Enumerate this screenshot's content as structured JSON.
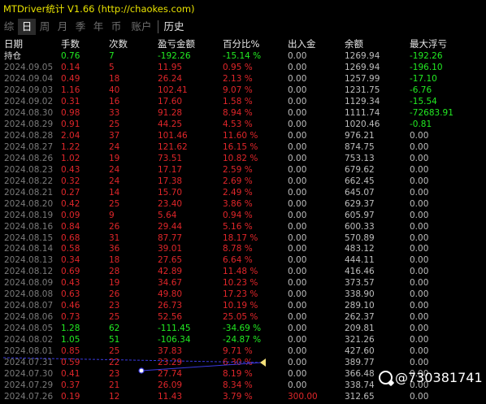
{
  "title": "MTDriver统计 V1.66  (http://chaokes.com)",
  "tabs": [
    "综",
    "日",
    "周",
    "月",
    "季",
    "年",
    "币",
    "账户",
    "历史"
  ],
  "columns": [
    "日期",
    "手数",
    "次数",
    "盈亏金额",
    "百分比%",
    "出入金",
    "余额",
    "最大浮亏"
  ],
  "holding": {
    "date": "持仓",
    "lots": "0.76",
    "count": "7",
    "pnl": "-192.26",
    "pct": "-15.14 %",
    "dw": "0.00",
    "balance": "1269.94",
    "maxdd": "-192.26"
  },
  "rows": [
    {
      "date": "2024.09.05",
      "lots": "0.14",
      "count": "5",
      "pnl": "11.95",
      "pct": "0.95 %",
      "dw": "0.00",
      "balance": "1269.94",
      "maxdd": "-196.10"
    },
    {
      "date": "2024.09.04",
      "lots": "0.49",
      "count": "18",
      "pnl": "26.24",
      "pct": "2.13 %",
      "dw": "0.00",
      "balance": "1257.99",
      "maxdd": "-17.10"
    },
    {
      "date": "2024.09.03",
      "lots": "1.16",
      "count": "40",
      "pnl": "102.41",
      "pct": "9.07 %",
      "dw": "0.00",
      "balance": "1231.75",
      "maxdd": "-6.76"
    },
    {
      "date": "2024.09.02",
      "lots": "0.31",
      "count": "16",
      "pnl": "17.60",
      "pct": "1.58 %",
      "dw": "0.00",
      "balance": "1129.34",
      "maxdd": "-15.54"
    },
    {
      "date": "2024.08.30",
      "lots": "0.98",
      "count": "33",
      "pnl": "91.28",
      "pct": "8.94 %",
      "dw": "0.00",
      "balance": "1111.74",
      "maxdd": "-72683.91"
    },
    {
      "date": "2024.08.29",
      "lots": "0.91",
      "count": "25",
      "pnl": "44.25",
      "pct": "4.53 %",
      "dw": "0.00",
      "balance": "1020.46",
      "maxdd": "-0.81"
    },
    {
      "date": "2024.08.28",
      "lots": "2.04",
      "count": "37",
      "pnl": "101.46",
      "pct": "11.60 %",
      "dw": "0.00",
      "balance": "976.21",
      "maxdd": "0.00"
    },
    {
      "date": "2024.08.27",
      "lots": "1.22",
      "count": "24",
      "pnl": "121.62",
      "pct": "16.15 %",
      "dw": "0.00",
      "balance": "874.75",
      "maxdd": "0.00"
    },
    {
      "date": "2024.08.26",
      "lots": "1.02",
      "count": "19",
      "pnl": "73.51",
      "pct": "10.82 %",
      "dw": "0.00",
      "balance": "753.13",
      "maxdd": "0.00"
    },
    {
      "date": "2024.08.23",
      "lots": "0.43",
      "count": "24",
      "pnl": "17.17",
      "pct": "2.59 %",
      "dw": "0.00",
      "balance": "679.62",
      "maxdd": "0.00"
    },
    {
      "date": "2024.08.22",
      "lots": "0.32",
      "count": "24",
      "pnl": "17.38",
      "pct": "2.69 %",
      "dw": "0.00",
      "balance": "662.45",
      "maxdd": "0.00"
    },
    {
      "date": "2024.08.21",
      "lots": "0.27",
      "count": "14",
      "pnl": "15.70",
      "pct": "2.49 %",
      "dw": "0.00",
      "balance": "645.07",
      "maxdd": "0.00"
    },
    {
      "date": "2024.08.20",
      "lots": "0.42",
      "count": "25",
      "pnl": "23.40",
      "pct": "3.86 %",
      "dw": "0.00",
      "balance": "629.37",
      "maxdd": "0.00"
    },
    {
      "date": "2024.08.19",
      "lots": "0.09",
      "count": "9",
      "pnl": "5.64",
      "pct": "0.94 %",
      "dw": "0.00",
      "balance": "605.97",
      "maxdd": "0.00"
    },
    {
      "date": "2024.08.16",
      "lots": "0.84",
      "count": "26",
      "pnl": "29.44",
      "pct": "5.16 %",
      "dw": "0.00",
      "balance": "600.33",
      "maxdd": "0.00"
    },
    {
      "date": "2024.08.15",
      "lots": "0.68",
      "count": "31",
      "pnl": "87.77",
      "pct": "18.17 %",
      "dw": "0.00",
      "balance": "570.89",
      "maxdd": "0.00"
    },
    {
      "date": "2024.08.14",
      "lots": "0.58",
      "count": "36",
      "pnl": "39.01",
      "pct": "8.78 %",
      "dw": "0.00",
      "balance": "483.12",
      "maxdd": "0.00"
    },
    {
      "date": "2024.08.13",
      "lots": "0.34",
      "count": "18",
      "pnl": "27.65",
      "pct": "6.64 %",
      "dw": "0.00",
      "balance": "444.11",
      "maxdd": "0.00"
    },
    {
      "date": "2024.08.12",
      "lots": "0.69",
      "count": "28",
      "pnl": "42.89",
      "pct": "11.48 %",
      "dw": "0.00",
      "balance": "416.46",
      "maxdd": "0.00"
    },
    {
      "date": "2024.08.09",
      "lots": "0.43",
      "count": "19",
      "pnl": "34.67",
      "pct": "10.23 %",
      "dw": "0.00",
      "balance": "373.57",
      "maxdd": "0.00"
    },
    {
      "date": "2024.08.08",
      "lots": "0.63",
      "count": "26",
      "pnl": "49.80",
      "pct": "17.23 %",
      "dw": "0.00",
      "balance": "338.90",
      "maxdd": "0.00"
    },
    {
      "date": "2024.08.07",
      "lots": "0.46",
      "count": "23",
      "pnl": "26.73",
      "pct": "10.19 %",
      "dw": "0.00",
      "balance": "289.10",
      "maxdd": "0.00"
    },
    {
      "date": "2024.08.06",
      "lots": "0.73",
      "count": "25",
      "pnl": "52.56",
      "pct": "25.05 %",
      "dw": "0.00",
      "balance": "262.37",
      "maxdd": "0.00"
    },
    {
      "date": "2024.08.05",
      "lots": "1.28",
      "count": "62",
      "pnl": "-111.45",
      "pct": "-34.69 %",
      "dw": "0.00",
      "balance": "209.81",
      "maxdd": "0.00"
    },
    {
      "date": "2024.08.02",
      "lots": "1.05",
      "count": "51",
      "pnl": "-106.34",
      "pct": "-24.87 %",
      "dw": "0.00",
      "balance": "321.26",
      "maxdd": "0.00"
    },
    {
      "date": "2024.08.01",
      "lots": "0.85",
      "count": "25",
      "pnl": "37.83",
      "pct": "9.71 %",
      "dw": "0.00",
      "balance": "427.60",
      "maxdd": "0.00"
    },
    {
      "date": "2024.07.31",
      "lots": "0.59",
      "count": "22",
      "pnl": "23.29",
      "pct": "6.30 %",
      "dw": "0.00",
      "balance": "389.77",
      "maxdd": "0.00"
    },
    {
      "date": "2024.07.30",
      "lots": "0.41",
      "count": "23",
      "pnl": "27.74",
      "pct": "8.19 %",
      "dw": "0.00",
      "balance": "366.48",
      "maxdd": "0.00"
    },
    {
      "date": "2024.07.29",
      "lots": "0.37",
      "count": "21",
      "pnl": "26.09",
      "pct": "8.34 %",
      "dw": "0.00",
      "balance": "338.74",
      "maxdd": "0.00"
    },
    {
      "date": "2024.07.26",
      "lots": "0.19",
      "count": "12",
      "pnl": "11.43",
      "pct": "3.79 %",
      "dw": "300.00",
      "balance": "312.65",
      "maxdd": "0.00"
    }
  ],
  "watermark": "@730381741",
  "colors": {
    "title": "#e8e200",
    "profit": "#e0262a",
    "loss": "#22ea22",
    "date": "#7a7a7a",
    "background": "#000000"
  }
}
